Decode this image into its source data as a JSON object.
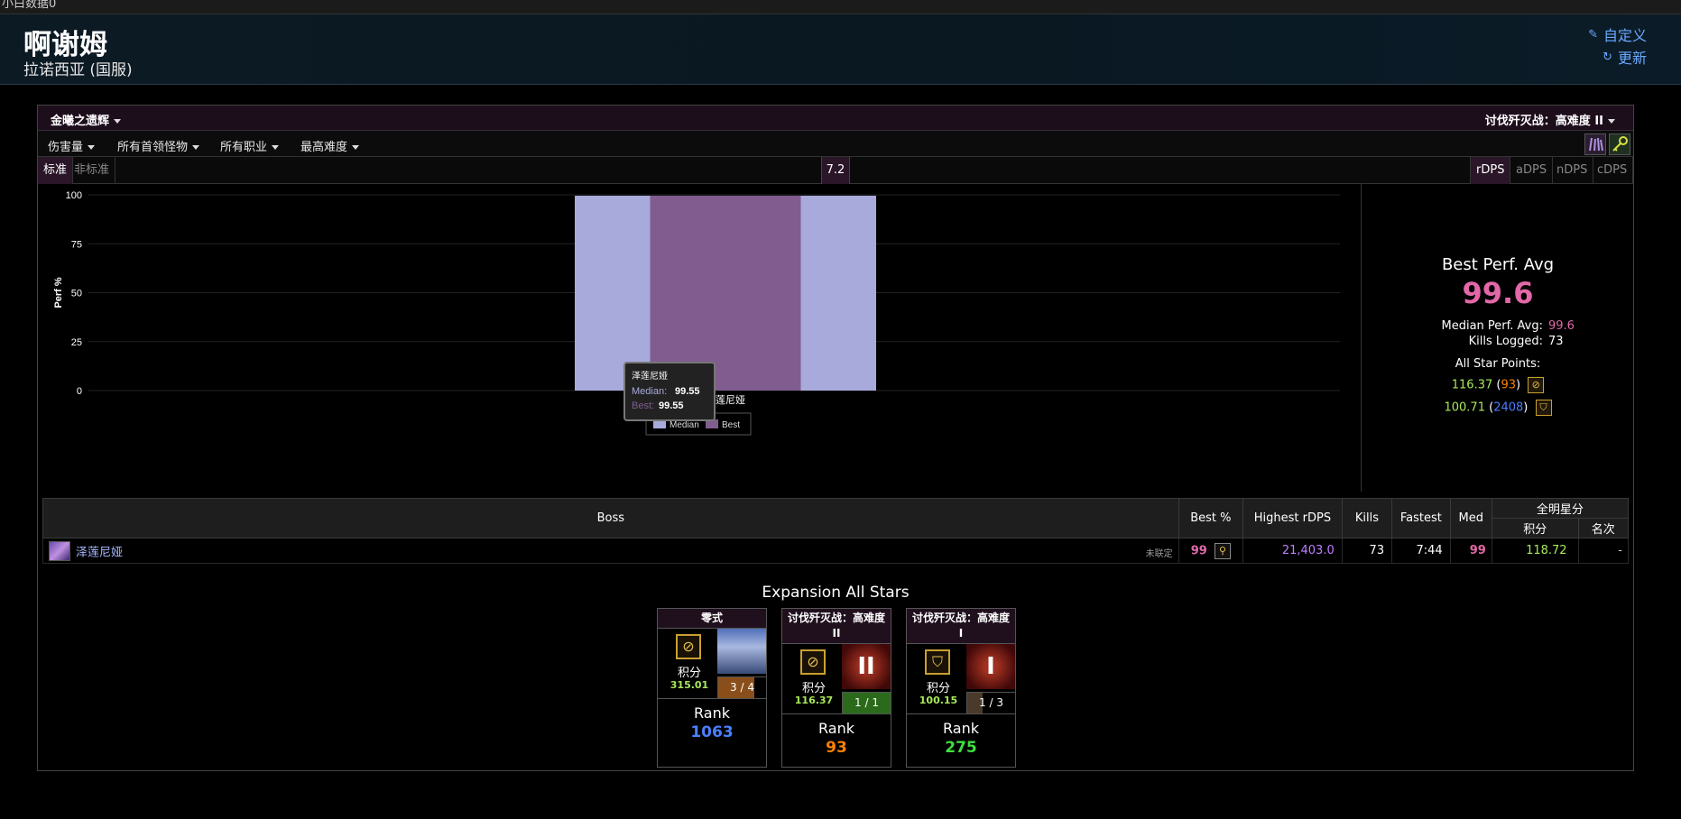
{
  "topstrip": {
    "text": "小白数据0"
  },
  "header": {
    "player_name": "啊谢姆",
    "server": "拉诺西亚 (国服)",
    "customize_label": "自定义",
    "refresh_label": "更新"
  },
  "zone_bar": {
    "zone": "金曦之遗辉",
    "encounter": "讨伐歼灭战：高难度 II"
  },
  "filters": [
    "伤害量",
    "所有首领怪物",
    "所有职业",
    "最高难度"
  ],
  "std_tabs": {
    "standard": "标准",
    "nonstandard": "非标准"
  },
  "version": "7.2",
  "dps_tabs": [
    "rDPS",
    "aDPS",
    "nDPS",
    "cDPS"
  ],
  "chart_data": {
    "type": "bar",
    "categories": [
      "泽莲尼娅"
    ],
    "series": [
      {
        "name": "Median",
        "values": [
          99.55
        ],
        "color": "#a8aadc"
      },
      {
        "name": "Best",
        "values": [
          99.55
        ],
        "color": "#805d8e"
      }
    ],
    "ylabel": "Perf %",
    "ylim": [
      0,
      100
    ],
    "yticks": [
      0,
      25,
      50,
      75,
      100
    ],
    "grid": true,
    "legend": "bottom-center",
    "tooltip": {
      "title": "泽莲尼娅",
      "median_label": "Median:",
      "median_value": "99.55",
      "best_label": "Best:",
      "best_value": "99.55"
    }
  },
  "stats": {
    "title": "Best Perf. Avg",
    "value": "99.6",
    "median_label": "Median Perf. Avg:",
    "median_value": "99.6",
    "kills_label": "Kills Logged:",
    "kills_value": "73",
    "allstar_label": "All Star Points:",
    "allstar_1_points": "116.37",
    "allstar_1_rank": "93",
    "allstar_2_points": "100.71",
    "allstar_2_rank": "2408"
  },
  "table": {
    "headers": {
      "boss": "Boss",
      "best": "Best %",
      "highest": "Highest rDPS",
      "kills": "Kills",
      "fastest": "Fastest",
      "med": "Med",
      "allstar": "全明星分",
      "points": "积分",
      "rank": "名次"
    },
    "row": {
      "boss": "泽莲尼娅",
      "unranked": "未联定",
      "best": "99",
      "highest": "21,403.0",
      "kills": "73",
      "fastest": "7:44",
      "med": "99",
      "points": "118.72",
      "rank": "-"
    }
  },
  "expansion": {
    "title": "Expansion All Stars",
    "cards": [
      {
        "name": "零式",
        "points_label": "积分",
        "points": "315.01",
        "progress": "3 / 4",
        "progress_fraction": 0.75,
        "rank_label": "Rank",
        "rank": "1063",
        "rank_color": "#4a7fff"
      },
      {
        "name": "讨伐歼灭战：高难度 II",
        "points_label": "积分",
        "points": "116.37",
        "progress": "1 / 1",
        "progress_fraction": 1.0,
        "rank_label": "Rank",
        "rank": "93",
        "rank_color": "#ff8000"
      },
      {
        "name": "讨伐歼灭战：高难度 I",
        "points_label": "积分",
        "points": "100.15",
        "progress": "1 / 3",
        "progress_fraction": 0.33,
        "rank_label": "Rank",
        "rank": "275",
        "rank_color": "#3ee03e"
      }
    ]
  }
}
